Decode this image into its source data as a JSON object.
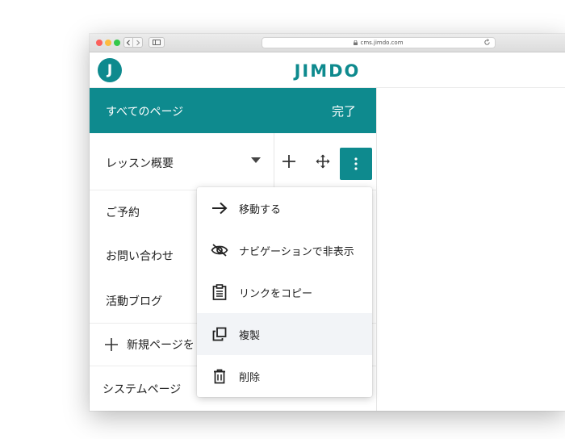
{
  "browser": {
    "url": "cms.jimdo.com"
  },
  "header": {
    "logo_letter": "J",
    "brand": "JIMDO"
  },
  "panel": {
    "title": "すべてのページ",
    "done_label": "完了",
    "selected_page": "レッスン概要",
    "pages": [
      "ご予約",
      "お問い合わせ",
      "活動ブログ"
    ],
    "add_page_label": "新規ページを",
    "system_pages_label": "システムページ"
  },
  "menu": {
    "items": [
      {
        "label": "移動する",
        "icon": "arrow-right-icon"
      },
      {
        "label": "ナビゲーションで非表示",
        "icon": "eye-off-icon"
      },
      {
        "label": "リンクをコピー",
        "icon": "clipboard-icon"
      },
      {
        "label": "複製",
        "icon": "duplicate-icon",
        "highlighted": true
      },
      {
        "label": "削除",
        "icon": "trash-icon"
      }
    ]
  },
  "colors": {
    "brand": "#0e8a8e",
    "menu_highlight": "#f2f4f7"
  }
}
